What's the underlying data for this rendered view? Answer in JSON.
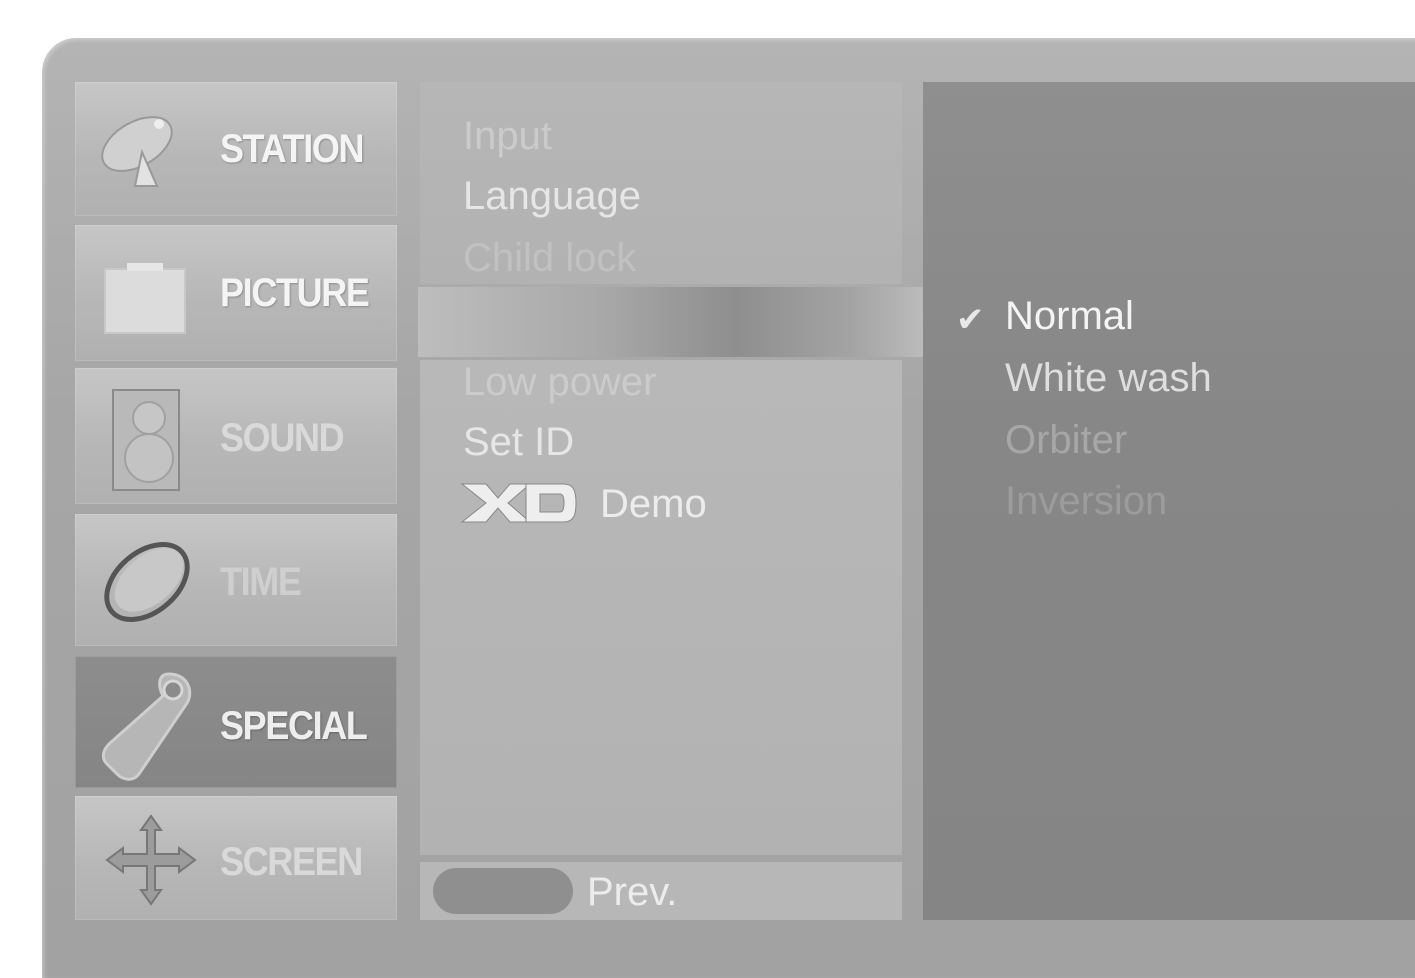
{
  "categories": [
    {
      "label": "STATION",
      "icon": "satellite-dish-icon",
      "state": "normal"
    },
    {
      "label": "PICTURE",
      "icon": "screen-icon",
      "state": "normal"
    },
    {
      "label": "SOUND",
      "icon": "speaker-icon",
      "state": "faded"
    },
    {
      "label": "TIME",
      "icon": "clock-icon",
      "state": "very-faded"
    },
    {
      "label": "SPECIAL",
      "icon": "tag-icon",
      "state": "active"
    },
    {
      "label": "SCREEN",
      "icon": "arrows-move-icon",
      "state": "faded"
    }
  ],
  "special_menu": {
    "items_top": [
      "Input",
      "Language",
      "Child lock"
    ],
    "items_bottom": [
      "Low power",
      "Set ID"
    ],
    "xd_logo": "XD",
    "xd_demo_label": "Demo"
  },
  "footer": {
    "prev_label": "Prev."
  },
  "options": {
    "items": [
      "Normal",
      "White wash",
      "Orbiter",
      "Inversion"
    ],
    "selected": "Normal",
    "check_mark": "✔"
  },
  "colors": {
    "panel": "#a6a6a6",
    "active_category": "#8a8a8a",
    "options_panel": "#8a8a8a"
  }
}
